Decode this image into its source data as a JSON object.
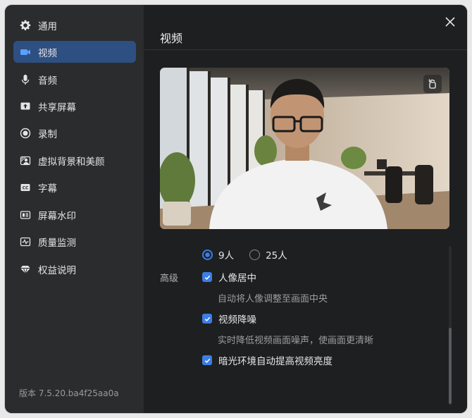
{
  "sidebar": {
    "items": [
      {
        "label": "通用",
        "icon": "gear-icon"
      },
      {
        "label": "视频",
        "icon": "video-camera-icon",
        "active": true
      },
      {
        "label": "音频",
        "icon": "microphone-icon"
      },
      {
        "label": "共享屏幕",
        "icon": "share-screen-icon"
      },
      {
        "label": "录制",
        "icon": "record-icon"
      },
      {
        "label": "虚拟背景和美颜",
        "icon": "virtual-background-icon"
      },
      {
        "label": "字幕",
        "icon": "captions-icon"
      },
      {
        "label": "屏幕水印",
        "icon": "watermark-icon"
      },
      {
        "label": "质量监测",
        "icon": "quality-monitor-icon"
      },
      {
        "label": "权益说明",
        "icon": "diamond-icon"
      }
    ],
    "version": "版本 7.5.20.ba4f25aa0a"
  },
  "main": {
    "title": "视频",
    "radio_options": [
      {
        "label": "9人",
        "selected": true
      },
      {
        "label": "25人",
        "selected": false
      }
    ],
    "advanced_label": "高级",
    "options": [
      {
        "label": "人像居中",
        "checked": true,
        "desc": "自动将人像调整至画面中央"
      },
      {
        "label": "视频降噪",
        "checked": true,
        "desc": "实时降低视频画面噪声，使画面更清晰"
      },
      {
        "label": "暗光环境自动提高视频亮度",
        "checked": true
      }
    ]
  },
  "colors": {
    "accent": "#3d7de6",
    "active_nav": "#2e4f82"
  }
}
